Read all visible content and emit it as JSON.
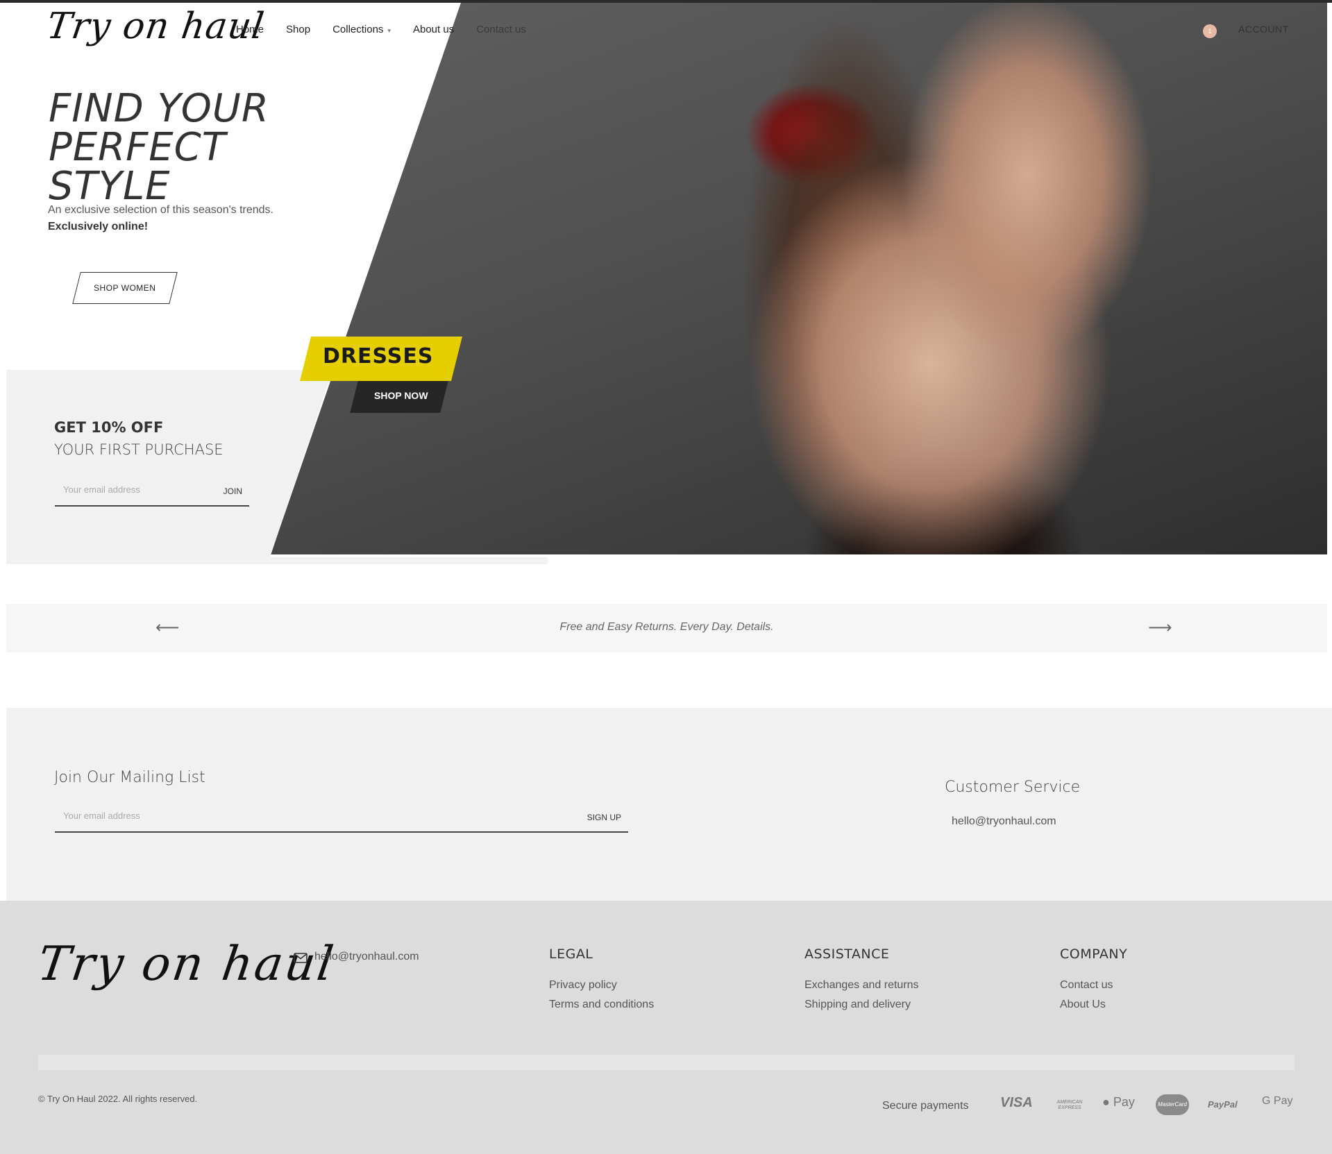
{
  "header": {
    "logo_text": "Try on haul",
    "nav": [
      {
        "label": "Home"
      },
      {
        "label": "Shop"
      },
      {
        "label": "Collections"
      },
      {
        "label": "About us"
      },
      {
        "label": "Contact us"
      }
    ],
    "cart_count": "1",
    "account_label": "ACCOUNT"
  },
  "hero": {
    "title_line1": "FIND YOUR PERFECT",
    "title_line2": "STYLE",
    "subtitle": "An exclusive selection of this season's trends.",
    "subtitle_bold": "Exclusively online!",
    "cta_label": "SHOP WOMEN",
    "tag_label": "DRESSES",
    "tag_cta": "SHOP NOW"
  },
  "promo": {
    "headline": "GET 10% OFF",
    "subline": "YOUR FIRST PURCHASE",
    "email_placeholder": "Your email address",
    "join_label": "JOIN"
  },
  "announcement": {
    "message": "Free and Easy Returns. Every Day. Details.",
    "prev_icon": "arrow-left-icon",
    "next_icon": "arrow-right-icon"
  },
  "mailing": {
    "title": "Join Our Mailing List",
    "email_placeholder": "Your email address",
    "signup_label": "SIGN UP"
  },
  "customer_service": {
    "title": "Customer Service",
    "email": "hello@tryonhaul.com"
  },
  "footer": {
    "logo_text": "Try on haul",
    "email": "hello@tryonhaul.com",
    "legal": {
      "title": "LEGAL",
      "links": [
        "Privacy policy",
        "Terms and conditions"
      ]
    },
    "assistance": {
      "title": "ASSISTANCE",
      "links": [
        "Exchanges and returns",
        "Shipping and delivery"
      ]
    },
    "company": {
      "title": "COMPANY",
      "links": [
        "Contact us",
        "About Us"
      ]
    },
    "copyright": "© Try On Haul 2022. All rights reserved.",
    "secure_payments": "Secure payments",
    "payments": {
      "visa": "VISA",
      "amex": "AMERICAN EXPRESS",
      "apple_pay": "Pay",
      "mastercard": "MasterCard",
      "paypal": "PayPal",
      "google_pay": "G Pay"
    }
  },
  "colors": {
    "accent_yellow": "#e6cf00",
    "dark_tag": "#262626",
    "promo_bg": "#f1f1f1",
    "footer_bg": "#dcdcdc",
    "cart_badge": "#e8b9a4"
  }
}
